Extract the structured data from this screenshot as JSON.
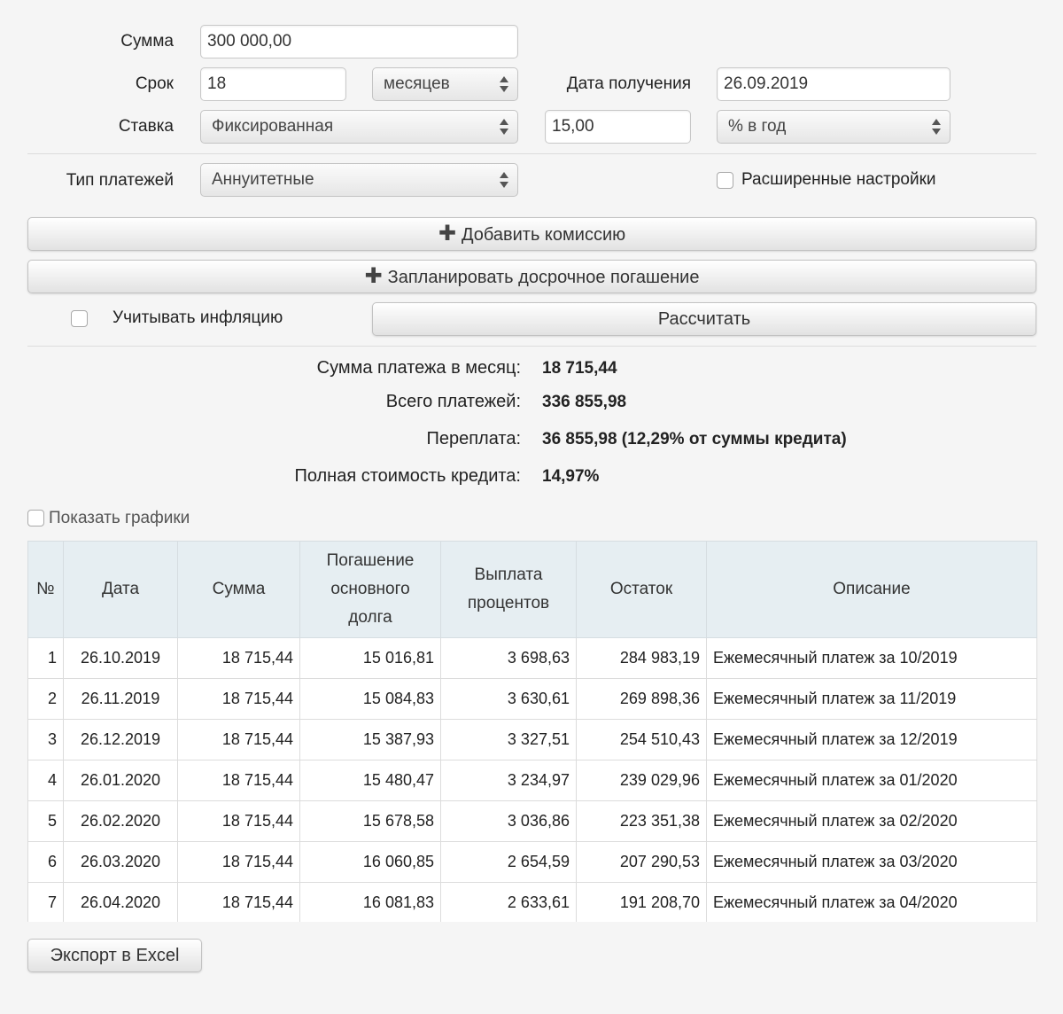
{
  "form": {
    "sum_label": "Сумма",
    "sum_value": "300 000,00",
    "term_label": "Срок",
    "term_value": "18",
    "term_unit": "месяцев",
    "date_label": "Дата получения",
    "date_value": "26.09.2019",
    "rate_label": "Ставка",
    "rate_type": "Фиксированная",
    "rate_value": "15,00",
    "rate_unit": "% в год",
    "payment_type_label": "Тип платежей",
    "payment_type": "Аннуитетные",
    "advanced_label": "Расширенные настройки",
    "add_commission": "Добавить комиссию",
    "plan_prepayment": "Запланировать досрочное погашение",
    "inflation_label": "Учитывать инфляцию",
    "calculate": "Рассчитать"
  },
  "summary": {
    "monthly_label": "Сумма платежа в месяц:",
    "monthly_value": "18 715,44",
    "total_label": "Всего платежей:",
    "total_value": "336 855,98",
    "overpay_label": "Переплата:",
    "overpay_value": "36 855,98 (12,29% от суммы кредита)",
    "full_cost_label": "Полная стоимость кредита:",
    "full_cost_value": "14,97%"
  },
  "charts_toggle_label": "Показать графики",
  "table": {
    "headers": [
      "№",
      "Дата",
      "Сумма",
      "Погашение основного долга",
      "Выплата процентов",
      "Остаток",
      "Описание"
    ],
    "rows": [
      [
        "1",
        "26.10.2019",
        "18 715,44",
        "15 016,81",
        "3 698,63",
        "284 983,19",
        "Ежемесячный платеж за 10/2019"
      ],
      [
        "2",
        "26.11.2019",
        "18 715,44",
        "15 084,83",
        "3 630,61",
        "269 898,36",
        "Ежемесячный платеж за 11/2019"
      ],
      [
        "3",
        "26.12.2019",
        "18 715,44",
        "15 387,93",
        "3 327,51",
        "254 510,43",
        "Ежемесячный платеж за 12/2019"
      ],
      [
        "4",
        "26.01.2020",
        "18 715,44",
        "15 480,47",
        "3 234,97",
        "239 029,96",
        "Ежемесячный платеж за 01/2020"
      ],
      [
        "5",
        "26.02.2020",
        "18 715,44",
        "15 678,58",
        "3 036,86",
        "223 351,38",
        "Ежемесячный платеж за 02/2020"
      ],
      [
        "6",
        "26.03.2020",
        "18 715,44",
        "16 060,85",
        "2 654,59",
        "207 290,53",
        "Ежемесячный платеж за 03/2020"
      ],
      [
        "7",
        "26.04.2020",
        "18 715,44",
        "16 081,83",
        "2 633,61",
        "191 208,70",
        "Ежемесячный платеж за 04/2020"
      ]
    ]
  },
  "export_label": "Экспорт в Excel"
}
